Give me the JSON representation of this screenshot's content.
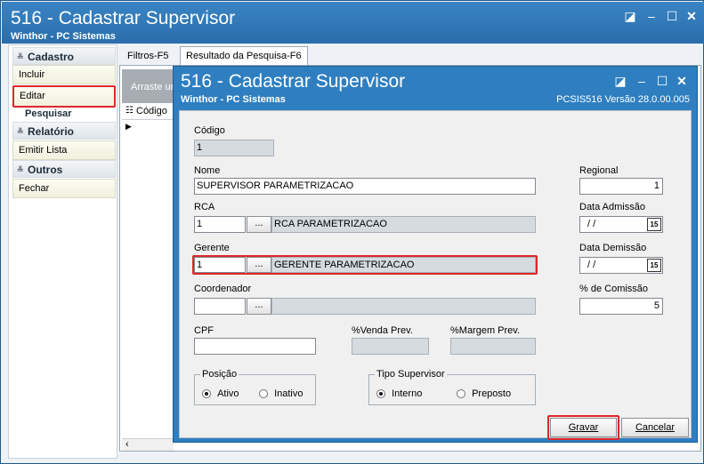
{
  "window": {
    "title": "516 - Cadastrar Supervisor",
    "subtitle": "Winthor - PC Sistemas"
  },
  "sidebar": {
    "groups": [
      {
        "label": "Cadastro",
        "items": [
          "Incluir",
          "Editar",
          "Pesquisar"
        ]
      },
      {
        "label": "Relatório",
        "items": [
          "Emitir Lista"
        ]
      },
      {
        "label": "Outros",
        "items": [
          "Fechar"
        ]
      }
    ]
  },
  "tabs": [
    "Filtros-F5",
    "Resultado da Pesquisa-F6"
  ],
  "grid": {
    "hint": "Arraste ur",
    "column": "Código"
  },
  "dialog": {
    "title": "516 - Cadastrar Supervisor",
    "subtitle": "Winthor - PC Sistemas",
    "version": "PCSIS516  Versão  28.0.00.005",
    "fields": {
      "codigo_label": "Código",
      "codigo_value": "1",
      "nome_label": "Nome",
      "nome_value": "SUPERVISOR PARAMETRIZACAO",
      "rca_label": "RCA",
      "rca_code": "1",
      "rca_name": "RCA PARAMETRIZACAO",
      "gerente_label": "Gerente",
      "gerente_code": "1",
      "gerente_name": "GERENTE PARAMETRIZACAO",
      "coordenador_label": "Coordenador",
      "coordenador_code": "",
      "coordenador_name": "",
      "cpf_label": "CPF",
      "cpf_value": "",
      "venda_prev_label": "%Venda Prev.",
      "margem_prev_label": "%Margem Prev.",
      "regional_label": "Regional",
      "regional_value": "1",
      "data_admissao_label": "Data Admissão",
      "data_admissao_value": " / /",
      "data_demissao_label": "Data Demissão",
      "data_demissao_value": " / /",
      "comissao_label": "% de Comissão",
      "comissao_value": "5",
      "dots": "..."
    },
    "posicao": {
      "label": "Posição",
      "options": [
        "Ativo",
        "Inativo"
      ],
      "selected": "Ativo"
    },
    "tipo": {
      "label": "Tipo Supervisor",
      "options": [
        "Interno",
        "Preposto"
      ],
      "selected": "Interno"
    },
    "buttons": {
      "gravar": "Gravar",
      "cancelar": "Cancelar"
    },
    "calendar_icon_text": "15"
  },
  "colors": {
    "title_bar": "#2f7fc0",
    "highlight": "#e0262a"
  }
}
